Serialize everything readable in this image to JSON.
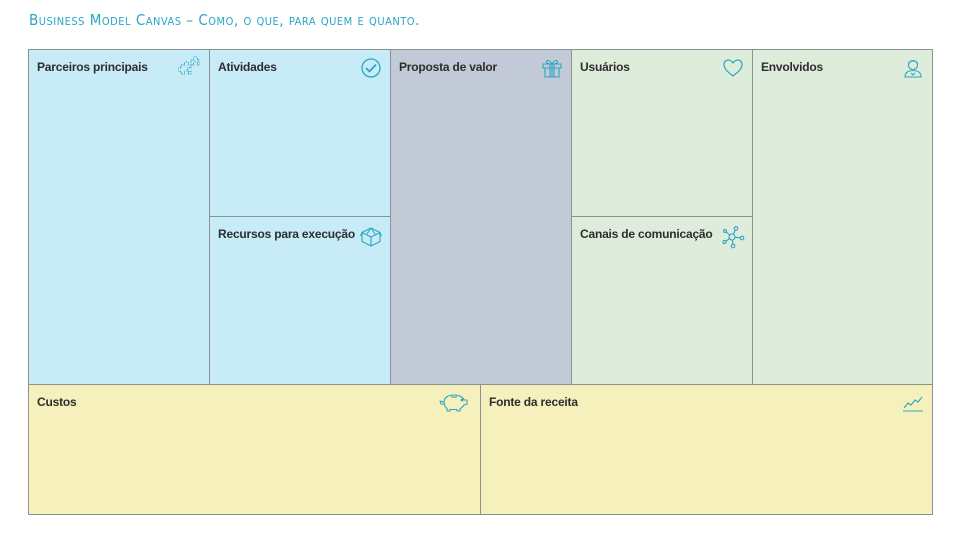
{
  "title": "Business Model Canvas – Como, o que, para quem e quanto.",
  "colors": {
    "title": "#2aa6c4",
    "icon": "#2aa6c4",
    "key_blocks": "#c7ecf8",
    "value_block": "#c2cad8",
    "customer_blocks": "#deecdb",
    "finance_blocks": "#f6f1bc",
    "border": "#8a9293"
  },
  "blocks": {
    "key_partners": {
      "label": "Parceiros principais",
      "icon": "puzzle-icon"
    },
    "key_activities": {
      "label": "Atividades",
      "icon": "check-circle-icon"
    },
    "key_resources": {
      "label": "Recursos para execução",
      "icon": "box-icon"
    },
    "value_proposition": {
      "label": "Proposta de valor",
      "icon": "gift-icon"
    },
    "customer_relationships": {
      "label": "Usuários",
      "icon": "heart-icon"
    },
    "channels": {
      "label": "Canais de comunicação",
      "icon": "network-icon"
    },
    "customer_segments": {
      "label": "Envolvidos",
      "icon": "person-icon"
    },
    "cost_structure": {
      "label": "Custos",
      "icon": "piggy-bank-icon"
    },
    "revenue_streams": {
      "label": "Fonte da receita",
      "icon": "line-chart-icon"
    }
  }
}
